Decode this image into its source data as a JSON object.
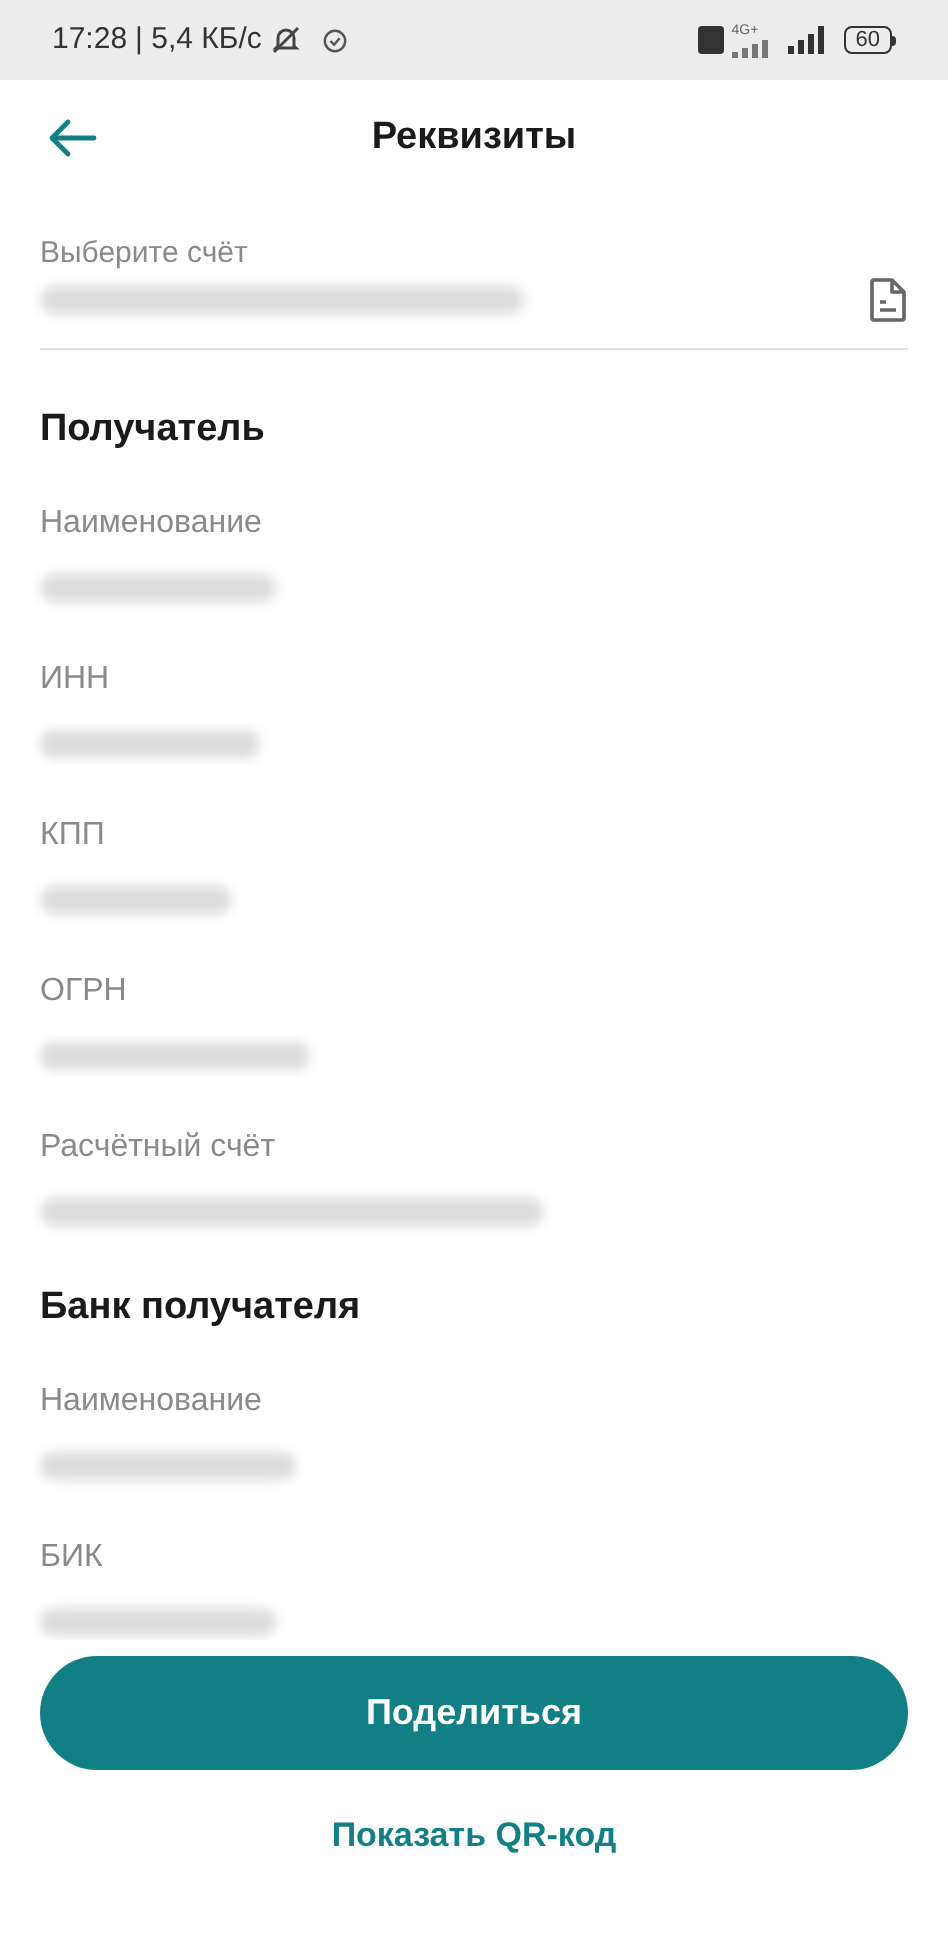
{
  "status_bar": {
    "time": "17:28",
    "speed": "| 5,4 КБ/с",
    "network": "4G+",
    "battery": "60"
  },
  "header": {
    "title": "Реквизиты"
  },
  "account": {
    "label": "Выберите счёт"
  },
  "sections": [
    {
      "title": "Получатель",
      "fields": [
        {
          "label": "Наименование"
        },
        {
          "label": "ИНН"
        },
        {
          "label": "КПП"
        },
        {
          "label": "ОГРН"
        },
        {
          "label": "Расчётный счёт"
        }
      ]
    },
    {
      "title": "Банк получателя",
      "fields": [
        {
          "label": "Наименование"
        },
        {
          "label": "БИК"
        }
      ]
    }
  ],
  "actions": {
    "primary": "Поделиться",
    "secondary": "Показать QR-код"
  }
}
